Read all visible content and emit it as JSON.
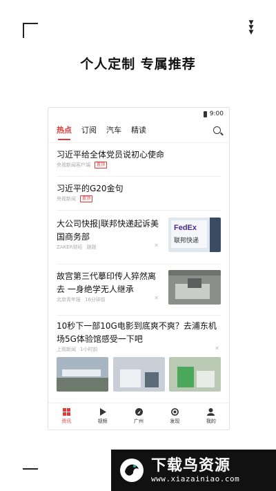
{
  "promo": {
    "title": "个人定制  专属推荐"
  },
  "status": {
    "time": "9:00"
  },
  "tabs": [
    "热点",
    "订阅",
    "汽车",
    "精读"
  ],
  "news": [
    {
      "title": "习近平给全体党员说初心使命",
      "source": "央视新闻客户端",
      "tag": "置顶"
    },
    {
      "title": "习近平的G20金句",
      "source": "央视新闻",
      "tag": "置顶"
    },
    {
      "title": "大公司快报|联邦快递起诉美国商务部",
      "source": "ZAKER财经",
      "time": "刚刚"
    },
    {
      "title": "故宫第三代摹印传人猝然离去 一身绝学无人继承",
      "source": "北京青年报",
      "time": "16分钟前"
    },
    {
      "title": "10秒下一部10G电影到底爽不爽？去浦东机场5G体验馆感受一下吧",
      "source": "上观新闻",
      "time": "1小时前"
    }
  ],
  "bottom_nav": [
    "资讯",
    "视频",
    "广州",
    "发现",
    "我的"
  ],
  "brand": {
    "name": "下载鸟资源",
    "url": "www.xiazainiao.com"
  },
  "colors": {
    "accent": "#e23a3a"
  }
}
